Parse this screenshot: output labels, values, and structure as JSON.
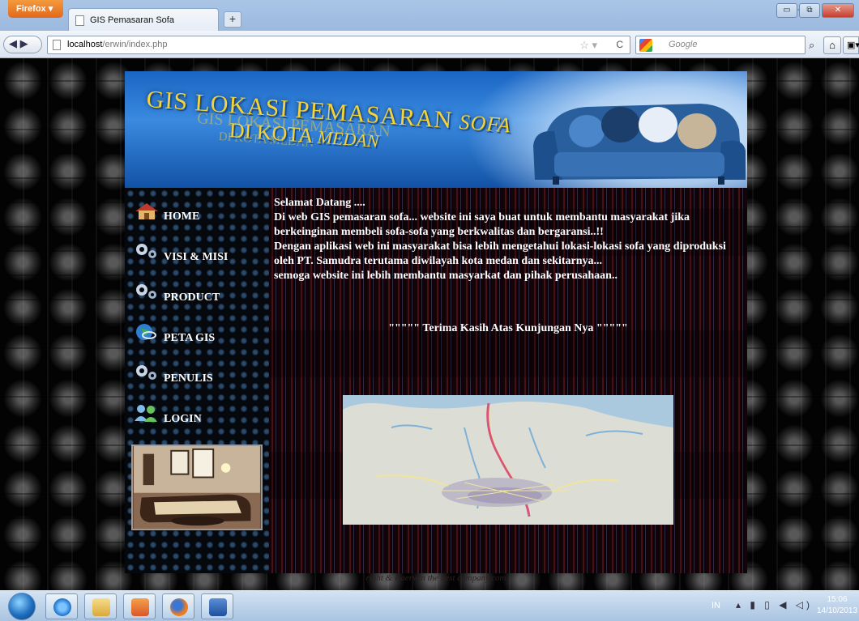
{
  "browser": {
    "menu_button": "Firefox ▾",
    "tab_title": "GIS Pemasaran Sofa",
    "new_tab": "+",
    "url_host": "localhost",
    "url_path": "/erwin/index.php",
    "search_placeholder": "Google",
    "back_forward": "◀ ▶",
    "url_star": "☆ ▾",
    "url_reload": "C",
    "search_go": "⌕",
    "home": "⌂",
    "bookmarks": "▣▾",
    "win_min": "▭",
    "win_max": "⧉",
    "win_close": "✕",
    "win_minus": "-"
  },
  "banner": {
    "title_line1_word1": "GIS LOKASI PEMASARAN ",
    "title_line1_word2": "SOFA",
    "title_line2_word1": "DI KOTA ",
    "title_line2_word2": "MEDAN"
  },
  "nav": {
    "items": [
      {
        "label": "HOME",
        "icon": "house-icon"
      },
      {
        "label": "VISI & MISI",
        "icon": "gears-icon"
      },
      {
        "label": "PRODUCT",
        "icon": "gears-icon"
      },
      {
        "label": "PETA GIS",
        "icon": "globe-icon"
      },
      {
        "label": "PENULIS",
        "icon": "gears-icon"
      },
      {
        "label": "LOGIN",
        "icon": "users-icon"
      }
    ]
  },
  "content": {
    "greeting": "Selamat Datang ....",
    "line1": "Di web GIS pemasaran sofa... website ini saya buat untuk membantu masyarakat jika",
    "line2": "berkeinginan membeli sofa-sofa yang berkwalitas dan bergaransi..!!",
    "line3": "Dengan aplikasi web ini masyarakat bisa lebih mengetahui lokasi-lokasi sofa yang diproduksi",
    "line4": "oleh PT. Samudra terutama diwilayah kota medan dan sekitarnya...",
    "line5": "semoga website ini lebih membantu masyarkat dan pihak perusahaan..",
    "thanks": "\"\"\"\"\" Terima Kasih Atas Kunjungan Nya \"\"\"\"\""
  },
  "footer": {
    "text": "right & Kaerwin the best company.com"
  },
  "taskbar": {
    "language": "IN",
    "tray": "▴ ▮ ▯ ◀ ◁)",
    "time": "15:06",
    "date": "14/10/2013"
  },
  "colors": {
    "banner_text": "#f2d33b",
    "nav_text": "#ffffff",
    "content_text": "#ffffff",
    "firefox_orange": "#e2681d"
  }
}
